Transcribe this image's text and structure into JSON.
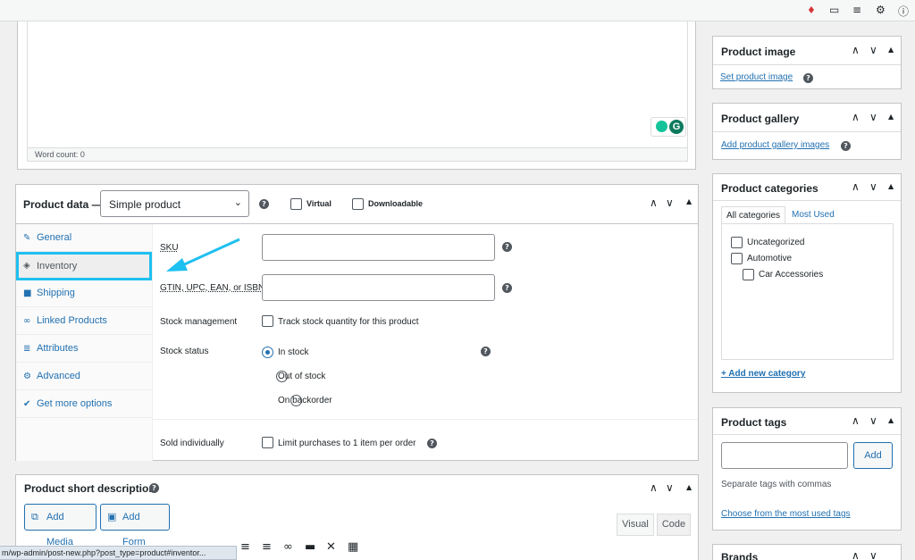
{
  "topbar": {
    "icons": [
      "bell-icon",
      "comment-icon",
      "list-icon",
      "gear-icon",
      "help-icon"
    ]
  },
  "editor_top": {
    "word_count": "Word count: 0"
  },
  "product_data": {
    "title": "Product data —",
    "type_select": "Simple product",
    "virtual_label": "Virtual",
    "downloadable_label": "Downloadable",
    "tabs": [
      {
        "label": "General",
        "icon": "wrench-icon"
      },
      {
        "label": "Inventory",
        "icon": "tag-icon"
      },
      {
        "label": "Shipping",
        "icon": "truck-icon"
      },
      {
        "label": "Linked Products",
        "icon": "link-icon"
      },
      {
        "label": "Attributes",
        "icon": "list-icon"
      },
      {
        "label": "Advanced",
        "icon": "gear-icon"
      },
      {
        "label": "Get more options",
        "icon": "plugin-icon"
      }
    ],
    "sku_label": "SKU",
    "gtin_label": "GTIN, UPC, EAN, or ISBN",
    "stock_management_label": "Stock management",
    "stock_management_option": "Track stock quantity for this product",
    "stock_status_label": "Stock status",
    "stock_options": [
      "In stock",
      "Out of stock",
      "On backorder"
    ],
    "sold_individually_label": "Sold individually",
    "sold_individually_option": "Limit purchases to 1 item per order"
  },
  "short_description": {
    "title": "Product short description",
    "add_media": "Add Media",
    "add_form": "Add Form",
    "visual_tab": "Visual",
    "code_tab": "Code"
  },
  "sidebar": {
    "product_image": {
      "title": "Product image",
      "link": "Set product image"
    },
    "product_gallery": {
      "title": "Product gallery",
      "link": "Add product gallery images"
    },
    "product_categories": {
      "title": "Product categories",
      "tab_all": "All categories",
      "tab_used": "Most Used",
      "items": [
        "Uncategorized",
        "Automotive",
        "Car Accessories"
      ],
      "add_link": "+ Add new category"
    },
    "product_tags": {
      "title": "Product tags",
      "add_button": "Add",
      "hint": "Separate tags with commas",
      "choose_link": "Choose from the most used tags"
    },
    "brands": {
      "title": "Brands"
    }
  },
  "statusbar": {
    "url": "m/wp-admin/post-new.php?post_type=product#inventor..."
  },
  "colors": {
    "accent": "#2271b1",
    "highlight": "#1ec0f0"
  }
}
